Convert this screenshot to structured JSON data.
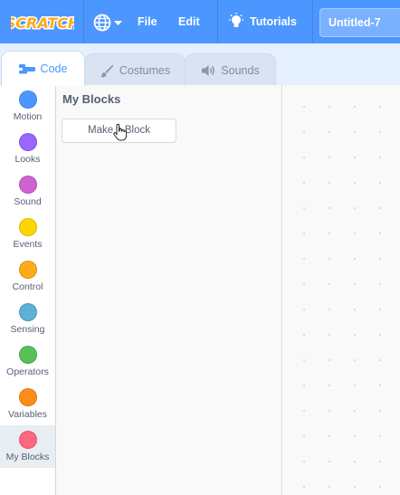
{
  "menubar": {
    "logo_text": "SCRATCH",
    "file_label": "File",
    "edit_label": "Edit",
    "tutorials_label": "Tutorials",
    "project_title": "Untitled-7",
    "color": "#4C97FF"
  },
  "tabs": [
    {
      "label": "Code",
      "icon": "code-icon",
      "active": true
    },
    {
      "label": "Costumes",
      "icon": "brush-icon",
      "active": false
    },
    {
      "label": "Sounds",
      "icon": "speaker-icon",
      "active": false
    }
  ],
  "categories": [
    {
      "label": "Motion",
      "color": "#4C97FF"
    },
    {
      "label": "Looks",
      "color": "#9966FF"
    },
    {
      "label": "Sound",
      "color": "#CF63CF"
    },
    {
      "label": "Events",
      "color": "#FFD500"
    },
    {
      "label": "Control",
      "color": "#FFAB19"
    },
    {
      "label": "Sensing",
      "color": "#5CB1D6"
    },
    {
      "label": "Operators",
      "color": "#59C059"
    },
    {
      "label": "Variables",
      "color": "#FF8C1A"
    },
    {
      "label": "My Blocks",
      "color": "#FF6680",
      "selected": true
    }
  ],
  "palette": {
    "title": "My Blocks",
    "make_block_label": "Make a Block"
  }
}
